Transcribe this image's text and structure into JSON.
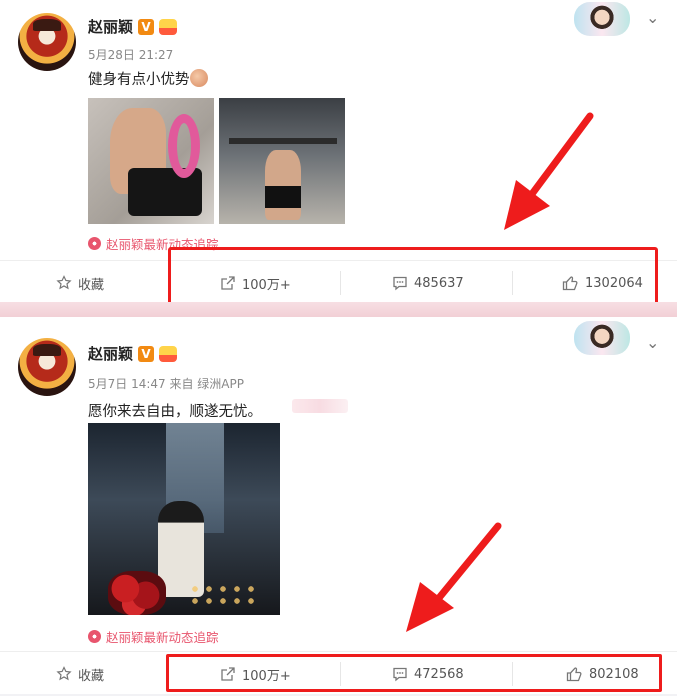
{
  "colors": {
    "accent_red": "#ee1c1c",
    "tracking_pink": "#e8556d",
    "v_orange": "#f28a12"
  },
  "posts": [
    {
      "username": "赵丽颖",
      "v_badge": "V",
      "meta": "5月28日 21:27",
      "text": "健身有点小优势",
      "tracking": "赵丽颖最新动态追踪",
      "actions": {
        "favorite": "收藏",
        "repost": "100万+",
        "comment": "485637",
        "like": "1302064"
      }
    },
    {
      "username": "赵丽颖",
      "v_badge": "V",
      "meta": "5月7日 14:47 来自 绿洲APP",
      "text": "愿你来去自由，顺遂无忧。",
      "tracking": "赵丽颖最新动态追踪",
      "actions": {
        "favorite": "收藏",
        "repost": "100万+",
        "comment": "472568",
        "like": "802108"
      }
    }
  ],
  "icons": [
    "star-icon",
    "repost-icon",
    "comment-icon",
    "like-icon",
    "chevron-down-icon",
    "tracking-flower-icon"
  ]
}
